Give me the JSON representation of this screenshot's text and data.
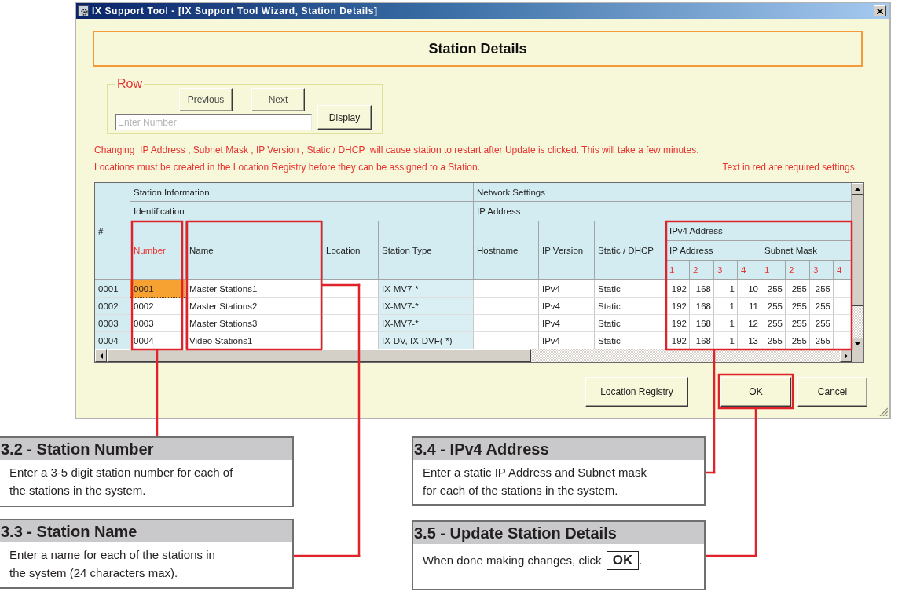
{
  "window": {
    "title": "IX Support Tool - [IX Support Tool Wizard, Station Details]"
  },
  "page_heading": "Station Details",
  "row_navigator": {
    "legend": "Row",
    "buttons": [
      "Previous",
      "Next"
    ],
    "input": {
      "placeholder": "Enter Number"
    },
    "display_button": "Display"
  },
  "notices": [
    "Changing  IP Address , Subnet Mask , IP Version , Static / DHCP  will cause station to restart after Update is clicked. This will take a few minutes.",
    "Locations must be created in the Location Registry before they can be assigned to a Station."
  ],
  "required_hint": "Text in red are required settings.",
  "table": {
    "corner": "#",
    "groups": [
      {
        "label": "Station Information",
        "subgroup": "Identification",
        "columns": [
          {
            "label": "Number",
            "required": true,
            "editable": true
          },
          {
            "label": "Name",
            "required": false,
            "editable": true
          },
          {
            "label": "Location",
            "required": false,
            "editable": true
          },
          {
            "label": "Station Type",
            "required": false,
            "editable": false
          }
        ]
      },
      {
        "label": "Network Settings",
        "subgroup": "IP Address",
        "columns": [
          {
            "label": "Hostname",
            "required": false,
            "editable": true
          },
          {
            "label": "IP Version",
            "required": false,
            "editable": true
          },
          {
            "label": "Static / DHCP",
            "required": false,
            "editable": true
          }
        ],
        "ipv4": {
          "label": "IPv4 Address",
          "parts": [
            {
              "label": "IP Address",
              "required": true,
              "octets": [
                "1",
                "2",
                "3",
                "4"
              ]
            },
            {
              "label": "Subnet Mask",
              "required": true,
              "octets": [
                "1",
                "2",
                "3",
                "4"
              ]
            }
          ]
        }
      }
    ],
    "rows": [
      {
        "index": "0001",
        "focused": true,
        "number": "0001",
        "name": "Master Stations1",
        "station_type": "IX-MV7-*",
        "ip_version": "IPv4",
        "assignment": "Static",
        "ip_address": [
          "192",
          "168",
          "1",
          "10"
        ],
        "subnet_mask": [
          "255",
          "255",
          "255"
        ]
      },
      {
        "index": "0002",
        "focused": false,
        "number": "0002",
        "name": "Master Stations2",
        "station_type": "IX-MV7-*",
        "ip_version": "IPv4",
        "assignment": "Static",
        "ip_address": [
          "192",
          "168",
          "1",
          "11"
        ],
        "subnet_mask": [
          "255",
          "255",
          "255"
        ]
      },
      {
        "index": "0003",
        "focused": false,
        "number": "0003",
        "name": "Master Stations3",
        "station_type": "IX-MV7-*",
        "ip_version": "IPv4",
        "assignment": "Static",
        "ip_address": [
          "192",
          "168",
          "1",
          "12"
        ],
        "subnet_mask": [
          "255",
          "255",
          "255"
        ]
      },
      {
        "index": "0004",
        "focused": false,
        "number": "0004",
        "name": "Video Stations1",
        "station_type": "IX-DV, IX-DVF(-*)",
        "ip_version": "IPv4",
        "assignment": "Static",
        "ip_address": [
          "192",
          "168",
          "1",
          "13"
        ],
        "subnet_mask": [
          "255",
          "255",
          "255"
        ]
      }
    ]
  },
  "buttons": [
    "Location Registry",
    "OK",
    "Cancel"
  ],
  "callouts": [
    {
      "title": "3.2 - Station Number",
      "body": "Enter a 3-5 digit station number for each of\nthe stations in the system."
    },
    {
      "title": "3.3 - Station Name",
      "body": "Enter a name for each of the stations in\nthe system (24 characters max)."
    },
    {
      "title": "3.4 - IPv4 Address",
      "body": "Enter a static IP Address and Subnet mask\nfor each of the stations in the system."
    },
    {
      "title": "3.5 - Update Station Details",
      "body": "When done making changes, click **OK**."
    }
  ]
}
